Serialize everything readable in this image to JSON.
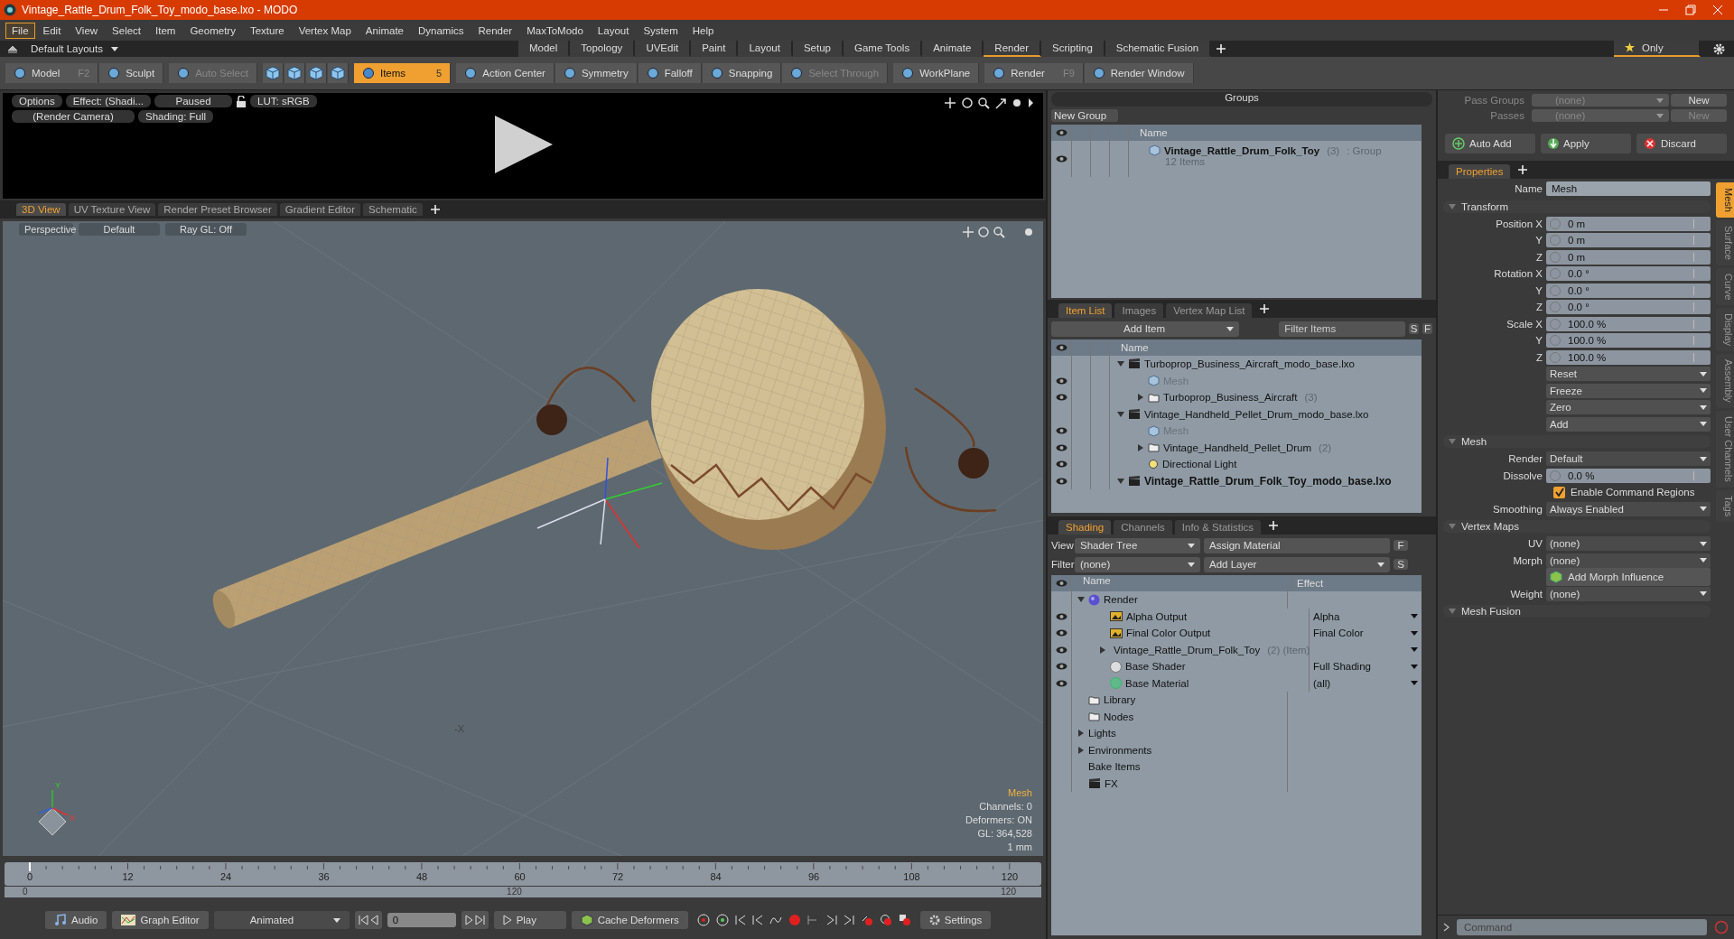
{
  "window": {
    "title": "Vintage_Rattle_Drum_Folk_Toy_modo_base.lxo - MODO"
  },
  "menu": [
    {
      "label": "File",
      "selected": true
    },
    {
      "label": "Edit",
      "selected": false
    },
    {
      "label": "View",
      "selected": false
    },
    {
      "label": "Select",
      "selected": false
    },
    {
      "label": "Item",
      "selected": false
    },
    {
      "label": "Geometry",
      "selected": false
    },
    {
      "label": "Texture",
      "selected": false
    },
    {
      "label": "Vertex Map",
      "selected": false
    },
    {
      "label": "Animate",
      "selected": false
    },
    {
      "label": "Dynamics",
      "selected": false
    },
    {
      "label": "Render",
      "selected": false
    },
    {
      "label": "MaxToModo",
      "selected": false
    },
    {
      "label": "Layout",
      "selected": false
    },
    {
      "label": "System",
      "selected": false
    },
    {
      "label": "Help",
      "selected": false
    }
  ],
  "layouts": {
    "label": "Default Layouts"
  },
  "layout_tabs": [
    {
      "label": "Model",
      "selected": false
    },
    {
      "label": "Topology",
      "selected": false
    },
    {
      "label": "UVEdit",
      "selected": false
    },
    {
      "label": "Paint",
      "selected": false
    },
    {
      "label": "Layout",
      "selected": false
    },
    {
      "label": "Setup",
      "selected": false
    },
    {
      "label": "Game Tools",
      "selected": false
    },
    {
      "label": "Animate",
      "selected": false
    },
    {
      "label": "Render",
      "selected": true
    },
    {
      "label": "Scripting",
      "selected": false
    },
    {
      "label": "Schematic Fusion",
      "selected": false
    }
  ],
  "only": {
    "label": "Only",
    "selected": true
  },
  "toolbar": [
    [
      {
        "kind": "text",
        "label": "Model",
        "shortcut": "F2",
        "disabled": false,
        "selected": false
      },
      {
        "kind": "text",
        "label": "Sculpt",
        "disabled": false,
        "selected": false
      }
    ],
    [
      {
        "kind": "text",
        "label": "Auto Select",
        "disabled": true,
        "selected": false
      }
    ],
    [
      {
        "kind": "icon"
      },
      {
        "kind": "icon"
      },
      {
        "kind": "icon"
      },
      {
        "kind": "icon"
      }
    ],
    [
      {
        "kind": "text",
        "label": "Items",
        "badge": "5",
        "disabled": false,
        "selected": true
      }
    ],
    [
      {
        "kind": "text",
        "label": "Action Center",
        "disabled": false,
        "selected": false
      },
      {
        "kind": "text",
        "label": "Symmetry",
        "disabled": false,
        "selected": false
      },
      {
        "kind": "text",
        "label": "Falloff",
        "disabled": false,
        "selected": false
      },
      {
        "kind": "text",
        "label": "Snapping",
        "disabled": false,
        "selected": false
      },
      {
        "kind": "text",
        "label": "Select Through",
        "disabled": true,
        "selected": false
      }
    ],
    [
      {
        "kind": "text",
        "label": "WorkPlane",
        "disabled": false,
        "selected": false
      }
    ],
    [
      {
        "kind": "text",
        "label": "Render",
        "shortcut": "F9",
        "disabled": false,
        "selected": false
      },
      {
        "kind": "text",
        "label": "Render Window",
        "disabled": false,
        "selected": false
      }
    ]
  ],
  "render_view": {
    "row1": [
      "Options",
      "Effect: (Shadi...",
      "Paused",
      "LUT: sRGB"
    ],
    "row2": [
      "(Render Camera)",
      "Shading: Full"
    ]
  },
  "viewport": {
    "tabs": [
      {
        "label": "3D View",
        "selected": true
      },
      {
        "label": "UV Texture View",
        "selected": false
      },
      {
        "label": "Render Preset Browser",
        "selected": false
      },
      {
        "label": "Gradient Editor",
        "selected": false
      },
      {
        "label": "Schematic",
        "selected": false
      }
    ],
    "buttons": [
      "Perspective",
      "Default",
      "Ray GL: Off"
    ],
    "selection": "Mesh",
    "info": [
      "Channels: 0",
      "Deformers: ON",
      "GL: 364,528",
      "1 mm"
    ],
    "axis_label": "-X",
    "gizmo_labels": [
      "Y",
      "X"
    ]
  },
  "timeline": {
    "ticks": [
      "0",
      "12",
      "24",
      "36",
      "48",
      "60",
      "72",
      "84",
      "96",
      "108",
      "120"
    ],
    "range_start": "0",
    "range_mid": "120",
    "range_end": "120"
  },
  "bottom_bar": {
    "audio": "Audio",
    "graph_editor": "Graph Editor",
    "mode": "Animated",
    "frame": "0",
    "play": "Play",
    "cache": "Cache Deformers",
    "settings": "Settings"
  },
  "groups_panel": {
    "title": "Groups",
    "new_button": "New Group",
    "column": "Name",
    "rows": [
      {
        "name": "Vintage_Rattle_Drum_Folk_Toy",
        "count": "(3)",
        "type": ": Group",
        "detail": "12 Items",
        "visible": true
      }
    ]
  },
  "passes": {
    "rows": [
      {
        "label": "Pass Groups",
        "value": "(none)",
        "button": "New",
        "disabled": false
      },
      {
        "label": "Passes",
        "value": "(none)",
        "button": "New",
        "disabled": true
      }
    ],
    "actions": [
      "Auto Add",
      "Apply",
      "Discard"
    ]
  },
  "item_list": {
    "tabs": [
      {
        "label": "Item List",
        "selected": true
      },
      {
        "label": "Images",
        "selected": false
      },
      {
        "label": "Vertex Map List",
        "selected": false
      }
    ],
    "add_button": "Add Item",
    "filter_placeholder": "Filter Items",
    "buttons": [
      "S",
      "F"
    ],
    "column": "Name",
    "items": [
      {
        "kind": "scene",
        "name": "Turboprop_Business_Aircraft_modo_base.lxo",
        "visible": false,
        "bold": false,
        "disabled": false,
        "expanded": true,
        "children": [
          {
            "kind": "mesh",
            "name": "Mesh",
            "visible": true,
            "bold": false,
            "disabled": true
          },
          {
            "kind": "group",
            "name": "Turboprop_Business_Aircraft",
            "count": "(3)",
            "visible": true,
            "bold": false,
            "disabled": false,
            "expanded": false
          }
        ]
      },
      {
        "kind": "scene",
        "name": "Vintage_Handheld_Pellet_Drum_modo_base.lxo",
        "visible": false,
        "bold": false,
        "disabled": false,
        "expanded": true,
        "children": [
          {
            "kind": "mesh",
            "name": "Mesh",
            "visible": true,
            "bold": false,
            "disabled": true
          },
          {
            "kind": "group",
            "name": "Vintage_Handheld_Pellet_Drum",
            "count": "(2)",
            "visible": true,
            "bold": false,
            "disabled": false,
            "expanded": false
          },
          {
            "kind": "light",
            "name": "Directional Light",
            "visible": true,
            "bold": false,
            "disabled": false
          }
        ]
      },
      {
        "kind": "scene",
        "name": "Vintage_Rattle_Drum_Folk_Toy_modo_base.lxo",
        "visible": true,
        "bold": true,
        "disabled": false,
        "expanded": true
      }
    ]
  },
  "shading": {
    "tabs": [
      {
        "label": "Shading",
        "selected": true
      },
      {
        "label": "Channels",
        "selected": false
      },
      {
        "label": "Info & Statistics",
        "selected": false
      }
    ],
    "view_label": "View",
    "view_value": "Shader Tree",
    "assign": "Assign Material",
    "assign_button": "F",
    "filter_label": "Filter",
    "filter_value": "(none)",
    "add_layer": "Add Layer",
    "add_button": "S",
    "columns": [
      "Name",
      "Effect"
    ],
    "items": [
      {
        "kind": "render",
        "name": "Render",
        "visible": false,
        "expanded": true,
        "children": [
          {
            "kind": "output",
            "name": "Alpha Output",
            "effect": "Alpha",
            "visible": true
          },
          {
            "kind": "output",
            "name": "Final Color Output",
            "effect": "Final Color",
            "visible": true
          },
          {
            "kind": "item",
            "name": "Vintage_Rattle_Drum_Folk_Toy",
            "count": "(2) (Item)",
            "visible": true,
            "expanded": false
          },
          {
            "kind": "shader",
            "name": "Base Shader",
            "effect": "Full Shading",
            "visible": true
          },
          {
            "kind": "material",
            "name": "Base Material",
            "effect": "(all)",
            "visible": true
          }
        ]
      },
      {
        "kind": "folder",
        "name": "Library",
        "visible": false
      },
      {
        "kind": "folder",
        "name": "Nodes",
        "visible": false
      },
      {
        "kind": "plain",
        "name": "Lights",
        "visible": false,
        "expanded": false
      },
      {
        "kind": "plain",
        "name": "Environments",
        "visible": false,
        "expanded": false
      },
      {
        "kind": "plain",
        "name": "Bake Items",
        "visible": false
      },
      {
        "kind": "fx",
        "name": "FX",
        "visible": false
      }
    ]
  },
  "properties": {
    "tab": "Properties",
    "side_tabs": [
      {
        "label": "Mesh",
        "selected": true
      },
      {
        "label": "Surface",
        "selected": false
      },
      {
        "label": "Curve",
        "selected": false
      },
      {
        "label": "Display",
        "selected": false
      },
      {
        "label": "Assembly",
        "selected": false
      },
      {
        "label": "User Channels",
        "selected": false
      },
      {
        "label": "Tags",
        "selected": false
      }
    ],
    "rows": [
      {
        "kind": "text",
        "label": "Name",
        "value": "Mesh"
      },
      {
        "kind": "section",
        "label": "Transform",
        "expanded": true
      },
      {
        "kind": "number",
        "label": "Position X",
        "value": "0 m"
      },
      {
        "kind": "number",
        "label": "Y",
        "value": "0 m"
      },
      {
        "kind": "number",
        "label": "Z",
        "value": "0 m"
      },
      {
        "kind": "number",
        "label": "Rotation X",
        "value": "0.0 °"
      },
      {
        "kind": "number",
        "label": "Y",
        "value": "0.0 °"
      },
      {
        "kind": "number",
        "label": "Z",
        "value": "0.0 °"
      },
      {
        "kind": "number",
        "label": "Scale X",
        "value": "100.0 %"
      },
      {
        "kind": "number",
        "label": "Y",
        "value": "100.0 %"
      },
      {
        "kind": "number",
        "label": "Z",
        "value": "100.0 %"
      },
      {
        "kind": "menu",
        "value": "Reset"
      },
      {
        "kind": "menu",
        "value": "Freeze"
      },
      {
        "kind": "menu",
        "value": "Zero"
      },
      {
        "kind": "menu",
        "value": "Add"
      },
      {
        "kind": "section",
        "label": "Mesh",
        "expanded": true
      },
      {
        "kind": "dropdown",
        "label": "Render",
        "value": "Default"
      },
      {
        "kind": "number",
        "label": "Dissolve",
        "value": "0.0 %"
      },
      {
        "kind": "checkbox",
        "label": "Enable Command Regions",
        "checked": true
      },
      {
        "kind": "dropdown",
        "label": "Smoothing",
        "value": "Always Enabled"
      },
      {
        "kind": "section",
        "label": "Vertex Maps",
        "expanded": true
      },
      {
        "kind": "dropdown",
        "label": "UV",
        "value": "(none)"
      },
      {
        "kind": "dropdown",
        "label": "Morph",
        "value": "(none)"
      },
      {
        "kind": "button",
        "label": "Add Morph Influence"
      },
      {
        "kind": "dropdown",
        "label": "Weight",
        "value": "(none)"
      },
      {
        "kind": "section",
        "label": "Mesh Fusion",
        "expanded": true
      }
    ],
    "command_placeholder": "Command"
  }
}
